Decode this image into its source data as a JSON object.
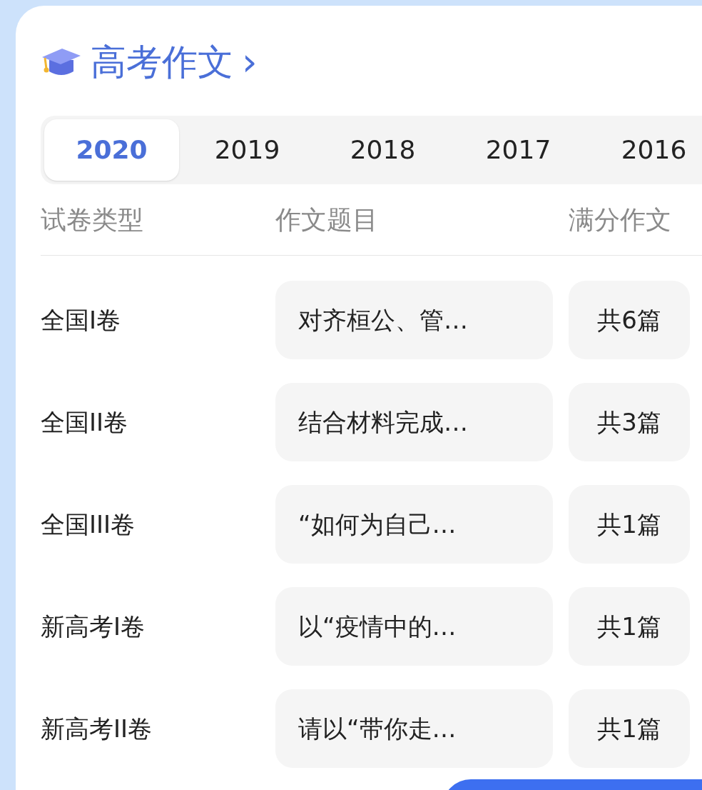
{
  "title": "高考作文",
  "title_chevron": "›",
  "year_tabs": [
    {
      "label": "2020",
      "selected": true
    },
    {
      "label": "2019",
      "selected": false
    },
    {
      "label": "2018",
      "selected": false
    },
    {
      "label": "2017",
      "selected": false
    },
    {
      "label": "2016",
      "selected": false
    }
  ],
  "table": {
    "columns": [
      "试卷类型",
      "作文题目",
      "满分作文"
    ],
    "rows": [
      {
        "paper": "全国I卷",
        "topic": "对齐桓公、管…",
        "count": "共6篇"
      },
      {
        "paper": "全国II卷",
        "topic": "结合材料完成…",
        "count": "共3篇"
      },
      {
        "paper": "全国III卷",
        "topic": "“如何为自己…",
        "count": "共1篇"
      },
      {
        "paper": "新高考I卷",
        "topic": "以“疫情中的…",
        "count": "共1篇"
      },
      {
        "paper": "新高考II卷",
        "topic": "请以“带你走…",
        "count": "共1篇"
      }
    ]
  }
}
